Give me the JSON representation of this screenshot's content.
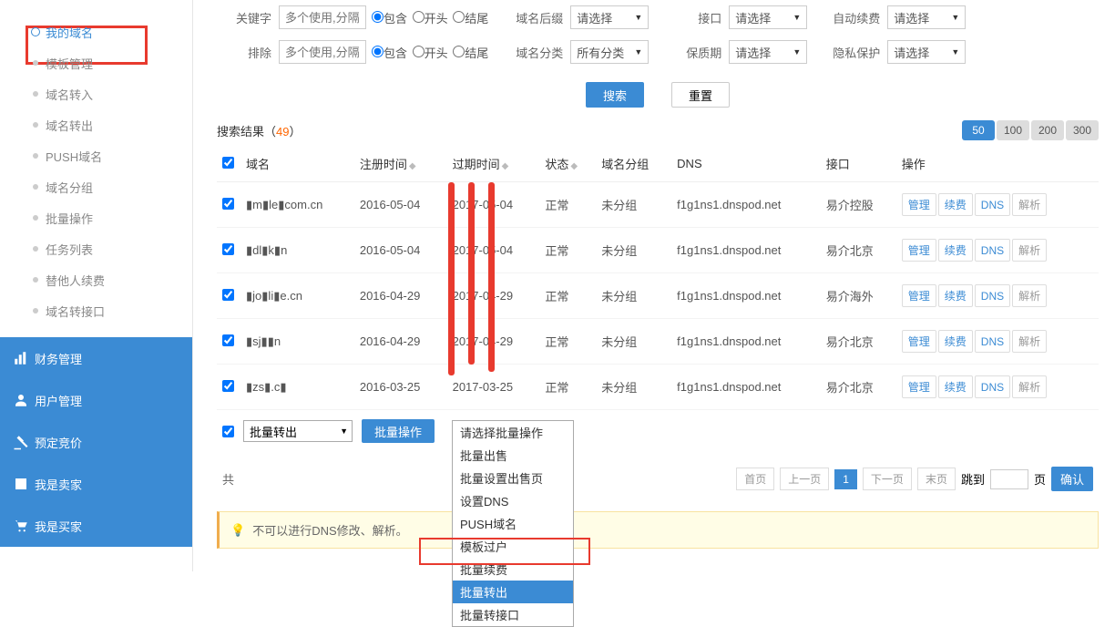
{
  "sidebar": {
    "items": [
      {
        "label": "我的域名",
        "active": true
      },
      {
        "label": "模板管理"
      },
      {
        "label": "域名转入"
      },
      {
        "label": "域名转出"
      },
      {
        "label": "PUSH域名"
      },
      {
        "label": "域名分组"
      },
      {
        "label": "批量操作"
      },
      {
        "label": "任务列表"
      },
      {
        "label": "替他人续费"
      },
      {
        "label": "域名转接口"
      }
    ],
    "main_items": [
      {
        "label": "财务管理",
        "icon": "chart"
      },
      {
        "label": "用户管理",
        "icon": "user"
      },
      {
        "label": "预定竞价",
        "icon": "gavel"
      },
      {
        "label": "我是卖家",
        "icon": "calendar"
      },
      {
        "label": "我是买家",
        "icon": "cart"
      }
    ]
  },
  "filters": {
    "keyword_label": "关键字",
    "keyword_placeholder": "多个使用,分隔",
    "radio_contain": "包含",
    "radio_start": "开头",
    "radio_end": "结尾",
    "suffix_label": "域名后缀",
    "suffix_value": "请选择",
    "iface_label": "接口",
    "iface_value": "请选择",
    "autorenew_label": "自动续费",
    "autorenew_value": "请选择",
    "exclude_label": "排除",
    "exclude_placeholder": "多个使用,分隔",
    "group_label": "域名分类",
    "group_value": "所有分类",
    "protection_label": "保质期",
    "protection_value": "请选择",
    "privacy_label": "隐私保护",
    "privacy_value": "请选择",
    "search_btn": "搜索",
    "reset_btn": "重置"
  },
  "results": {
    "title_prefix": "搜索结果（",
    "count": "49",
    "title_suffix": "）",
    "page_sizes": [
      "50",
      "100",
      "200",
      "300"
    ],
    "headers": {
      "domain": "域名",
      "regtime": "注册时间",
      "exptime": "过期时间",
      "status": "状态",
      "group": "域名分组",
      "dns": "DNS",
      "iface": "接口",
      "ops": "操作"
    },
    "op_labels": {
      "manage": "管理",
      "renew": "续费",
      "dns": "DNS",
      "resolve": "解析"
    },
    "rows": [
      {
        "domain": "▮m▮le▮com.cn",
        "reg": "2016-05-04",
        "exp": "2017-05-04",
        "status": "正常",
        "group": "未分组",
        "dns": "f1g1ns1.dnspod.net",
        "iface": "易介控股"
      },
      {
        "domain": "▮dl▮k▮n",
        "reg": "2016-05-04",
        "exp": "2017-05-04",
        "status": "正常",
        "group": "未分组",
        "dns": "f1g1ns1.dnspod.net",
        "iface": "易介北京"
      },
      {
        "domain": "▮jo▮li▮e.cn",
        "reg": "2016-04-29",
        "exp": "2017-04-29",
        "status": "正常",
        "group": "未分组",
        "dns": "f1g1ns1.dnspod.net",
        "iface": "易介海外"
      },
      {
        "domain": "▮sj▮▮n",
        "reg": "2016-04-29",
        "exp": "2017-04-29",
        "status": "正常",
        "group": "未分组",
        "dns": "f1g1ns1.dnspod.net",
        "iface": "易介北京"
      },
      {
        "domain": "▮zs▮.c▮",
        "reg": "2016-03-25",
        "exp": "2017-03-25",
        "status": "正常",
        "group": "未分组",
        "dns": "f1g1ns1.dnspod.net",
        "iface": "易介北京"
      }
    ]
  },
  "batch": {
    "select_value": "批量转出",
    "action_btn": "批量操作",
    "options": [
      "请选择批量操作",
      "批量出售",
      "批量设置出售页",
      "设置DNS",
      "PUSH域名",
      "模板过户",
      "批量续费",
      "批量转出",
      "批量转接口"
    ]
  },
  "pagination": {
    "total_prefix": "共",
    "first": "首页",
    "prev": "上一页",
    "current": "1",
    "next": "下一页",
    "last": "末页",
    "jump_label": "跳到",
    "page_suffix": "页",
    "confirm": "确认"
  },
  "notice": {
    "text": "不可以进行DNS修改、解析。"
  }
}
